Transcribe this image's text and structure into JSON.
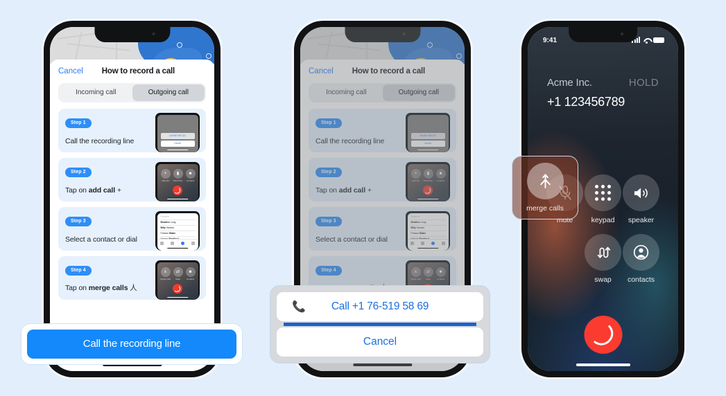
{
  "theme": {
    "page_bg": "#e2eefb",
    "accent_blue": "#1489fb",
    "link_blue": "#2f7cf6",
    "step_card_bg": "#e6f1fd",
    "badge_blue": "#2f8ef7",
    "end_call_red": "#fb3b30",
    "highlight_border": "#c8d7ea"
  },
  "tutorial": {
    "cancel_label": "Cancel",
    "title": "How to record a call",
    "segments": [
      {
        "label": "Incoming call",
        "active": false
      },
      {
        "label": "Outgoing call",
        "active": true
      }
    ],
    "steps": [
      {
        "badge": "Step 1",
        "text": "Call the recording line",
        "text_bold": "",
        "text_suffix": "",
        "thumb": "dial-sheet"
      },
      {
        "badge": "Step 2",
        "text": "Tap on ",
        "text_bold": "add call",
        "text_suffix": " +",
        "thumb": "call-controls"
      },
      {
        "badge": "Step 3",
        "text": "Select a contact or dial",
        "text_bold": "",
        "text_suffix": "",
        "thumb": "contact-list"
      },
      {
        "badge": "Step 4",
        "text": "Tap on ",
        "text_bold": "merge calls",
        "text_suffix": " 人",
        "thumb": "merge-controls"
      }
    ],
    "thumb_sheet": {
      "primary": "Call 987 654 321",
      "secondary": "Cancel"
    },
    "thumb_call_labels": [
      "add call",
      "FaceTime",
      "contacts"
    ],
    "thumb_merge_labels": [
      "merge calls",
      "swap",
      "contacts"
    ],
    "thumb_contacts": [
      {
        "first": "Beatrice",
        "last": "Long"
      },
      {
        "first": "Billy",
        "last": "Hanson"
      },
      {
        "first": "Preston",
        "last": "Blake"
      },
      {
        "first": "Warren",
        "last": "Bradford"
      }
    ]
  },
  "cta": {
    "button_label": "Call the recording line"
  },
  "dialog": {
    "call_label": "Call +1 76-519 58 69",
    "cancel_label": "Cancel",
    "phone_icon": "phone-icon"
  },
  "call_screen": {
    "status": {
      "time": "9:41",
      "signal_icon": "cellular-signal-icon",
      "wifi_icon": "wifi-icon",
      "battery_icon": "battery-icon"
    },
    "caller_name": "Acme Inc.",
    "call_state": "HOLD",
    "phone_number": "+1 123456789",
    "controls": [
      {
        "label": "mute",
        "icon": "microphone-off-icon",
        "highlighted": false
      },
      {
        "label": "keypad",
        "icon": "keypad-icon",
        "highlighted": false
      },
      {
        "label": "speaker",
        "icon": "speaker-icon",
        "highlighted": false
      },
      {
        "label": "swap",
        "icon": "swap-icon",
        "highlighted": false
      },
      {
        "label": "contacts",
        "icon": "contacts-icon",
        "highlighted": false
      }
    ],
    "merge": {
      "label": "merge calls",
      "icon": "merge-calls-icon",
      "highlighted": true
    },
    "end_call": {
      "icon": "end-call-icon"
    }
  }
}
